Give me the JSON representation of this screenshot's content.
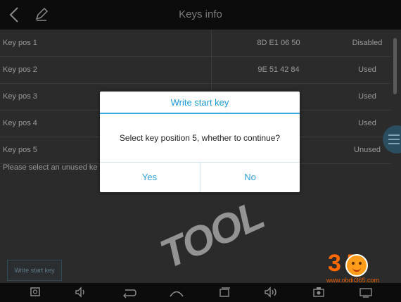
{
  "header": {
    "title": "Keys info",
    "back_icon": "back-arrow-icon",
    "edit_icon": "pencil-icon"
  },
  "keys": [
    {
      "pos": "Key pos 1",
      "code": "8D E1 06 50",
      "status": "Disabled"
    },
    {
      "pos": "Key pos 2",
      "code": "9E 51 42 84",
      "status": "Used"
    },
    {
      "pos": "Key pos 3",
      "code": "",
      "status": "Used"
    },
    {
      "pos": "Key pos 4",
      "code": "",
      "status": "Used"
    },
    {
      "pos": "Key pos 5",
      "code": "",
      "status": "Unused"
    }
  ],
  "hint": "Please select an unused ke",
  "write_button": "Write start key",
  "dialog": {
    "title": "Write start key",
    "message": "Select key position 5, whether to continue?",
    "yes": "Yes",
    "no": "No"
  },
  "watermark": "TOOL",
  "brand": {
    "number": "3  5",
    "url": "www.obdii365.com"
  },
  "nav_icons": [
    "screenshot-icon",
    "volume-down-icon",
    "back-icon",
    "home-icon",
    "recent-apps-icon",
    "volume-up-icon",
    "camera-icon",
    "cast-icon"
  ],
  "colors": {
    "accent": "#1c9ad6",
    "brand_orange": "#ff6a00"
  }
}
